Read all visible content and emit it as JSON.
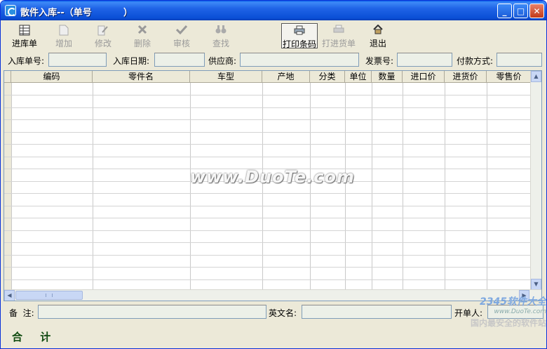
{
  "window": {
    "title": "散件入库--（单号          ）"
  },
  "toolbar": [
    {
      "label": "进库单",
      "icon": "grid-icon",
      "state": "enabled"
    },
    {
      "label": "增加",
      "icon": "new-doc-icon",
      "state": "disabled"
    },
    {
      "label": "修改",
      "icon": "edit-doc-icon",
      "state": "disabled"
    },
    {
      "label": "删除",
      "icon": "delete-x-icon",
      "state": "disabled"
    },
    {
      "label": "审核",
      "icon": "checkmark-icon",
      "state": "disabled"
    },
    {
      "label": "查找",
      "icon": "binoculars-icon",
      "state": "disabled"
    },
    {
      "label": "打印条码",
      "icon": "printer-icon",
      "state": "pressed"
    },
    {
      "label": "打进货单",
      "icon": "print-doc-icon",
      "state": "disabled"
    },
    {
      "label": "退出",
      "icon": "home-exit-icon",
      "state": "enabled"
    }
  ],
  "header": {
    "in_no_label": "入库单号:",
    "in_date_label": "入库日期:",
    "supplier_label": "供应商:",
    "invoice_label": "发票号:",
    "payment_label": "付款方式:"
  },
  "grid": {
    "columns": [
      "编码",
      "零件名",
      "车型",
      "产地",
      "分类",
      "单位",
      "数量",
      "进口价",
      "进货价",
      "零售价"
    ]
  },
  "footer": {
    "remark_label": "备  注:",
    "english_label": "英文名:",
    "issuer_label": "开单人:",
    "total_label": "合 计",
    "total_colon": ":"
  },
  "watermarks": {
    "center": "www.DuoTe.com",
    "corner_brand": "2345软件大全",
    "corner_url": "www.DuoTe.com",
    "corner_slogan": "国内最安全的软件站"
  },
  "colors": {
    "titlebar": "#0a4fd6",
    "face": "#ece9d8",
    "field_fill": "#ecf0e8",
    "total_text": "#0f4a0f"
  }
}
